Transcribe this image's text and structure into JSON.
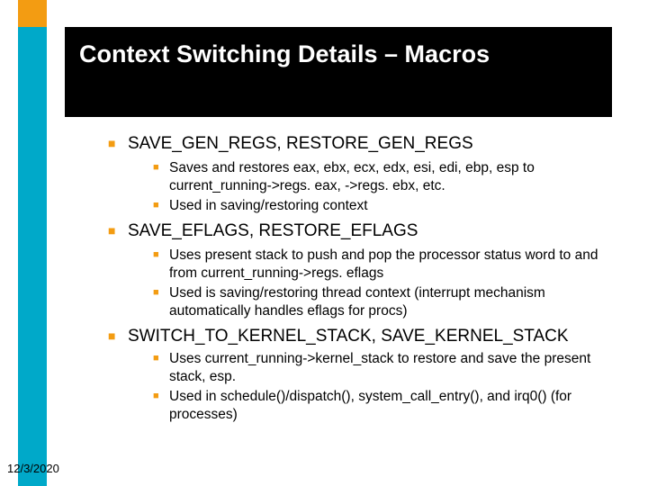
{
  "title": "Context Switching Details – Macros",
  "bullets": {
    "b1": "SAVE_GEN_REGS, RESTORE_GEN_REGS",
    "b1s1": "Saves and restores eax, ebx, ecx, edx, esi, edi, ebp, esp to current_running->regs. eax, ->regs. ebx, etc.",
    "b1s2": "Used in saving/restoring context",
    "b2": "SAVE_EFLAGS, RESTORE_EFLAGS",
    "b2s1": "Uses present stack to push and pop the processor status word to and from current_running->regs. eflags",
    "b2s2": "Used is saving/restoring thread context (interrupt mechanism automatically handles eflags for procs)",
    "b3": "SWITCH_TO_KERNEL_STACK, SAVE_KERNEL_STACK",
    "b3s1": "Uses current_running->kernel_stack to restore and save the present stack, esp.",
    "b3s2": "Used in schedule()/dispatch(), system_call_entry(), and irq0() (for processes)"
  },
  "date": "12/3/2020"
}
